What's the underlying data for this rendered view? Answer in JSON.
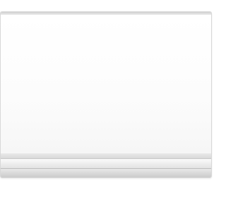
{
  "appliance": {
    "type_icon": "air-conditioner-indoor-unit-icon",
    "colors": {
      "body": "#ffffff",
      "rim": "#d9d9d9",
      "louver_light": "#e2e2e2",
      "louver_dark": "#c8c8c8",
      "outline": "#d8d8d8"
    }
  }
}
